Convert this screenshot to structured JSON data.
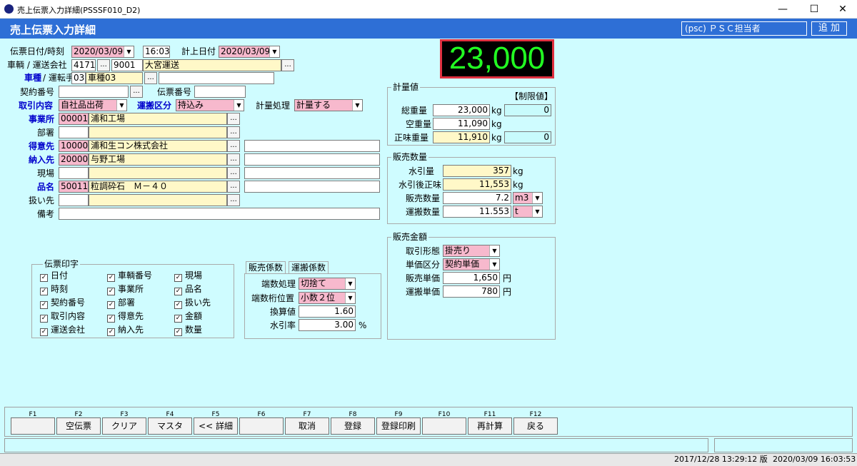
{
  "window": {
    "title": "売上伝票入力詳細(PSSSF010_D2)",
    "minimize": "—",
    "maximize": "☐",
    "close": "✕"
  },
  "header": {
    "title": "売上伝票入力詳細",
    "user": "(psc) ＰＳＣ担当者",
    "add_label": "追 加"
  },
  "big_weight": "23,000",
  "form": {
    "slip_date_label": "伝票日付/時刻",
    "slip_date": "2020/03/09",
    "slip_time": "16:03",
    "calc_date_label": "計上日付",
    "calc_date": "2020/03/09",
    "vehicle_label": "車輌 / 運送会社",
    "vehicle_no": "4171",
    "carrier_code": "9001",
    "carrier_name": "大宮運送",
    "vtype_label": "車種",
    "driver_label": "/ 運転手",
    "vtype_code": "03",
    "vtype_name": "車種03",
    "driver_value": "",
    "contract_label": "契約番号",
    "contract_value": "",
    "slip_no_label": "伝票番号",
    "slip_no_value": "",
    "trans_label": "取引内容",
    "trans_value": "自社品出荷",
    "transport_label": "運搬区分",
    "transport_value": "持込み",
    "weigh_label": "計量処理",
    "weigh_value": "計量する",
    "office_label": "事業所",
    "office_code": "00001",
    "office_name": "浦和工場",
    "dept_label": "部署",
    "dept_code": "",
    "dept_name": "",
    "customer_label": "得意先",
    "customer_code": "100000",
    "customer_name": "浦和生コン株式会社",
    "customer_extra": "",
    "delivery_label": "納入先",
    "delivery_code": "20000",
    "delivery_name": "与野工場",
    "delivery_extra": "",
    "site_label": "現場",
    "site_code": "",
    "site_name": "",
    "site_extra": "",
    "product_label": "品名",
    "product_code": "50011",
    "product_name": "粒調砕石　Ｍ－４０",
    "product_extra": "",
    "handler_label": "扱い先",
    "handler_code": "",
    "handler_name": "",
    "memo_label": "備考",
    "memo_value": ""
  },
  "print_group": {
    "caption": "伝票印字",
    "items": [
      "日付",
      "時刻",
      "契約番号",
      "取引内容",
      "運送会社",
      "車輌番号",
      "事業所",
      "部署",
      "得意先",
      "納入先",
      "現場",
      "品名",
      "扱い先",
      "金額",
      "数量"
    ]
  },
  "tabs": {
    "tab1": "販売係数",
    "tab2": "運搬係数",
    "round_label": "端数処理",
    "round_value": "切捨て",
    "digit_label": "端数桁位置",
    "digit_value": "小数２位",
    "conv_label": "換算値",
    "conv_value": "1.60",
    "water_label": "水引率",
    "water_value": "3.00",
    "water_unit": "%"
  },
  "weights": {
    "caption": "計量値",
    "limit_label": "【制限値】",
    "gross_label": "総重量",
    "gross": "23,000",
    "gross_limit": "0",
    "tare_label": "空重量",
    "tare": "11,090",
    "net_label": "正味重量",
    "net": "11,910",
    "net_limit": "0",
    "unit": "kg"
  },
  "sales_qty": {
    "caption": "販売数量",
    "water_label": "水引量",
    "water": "357",
    "water_unit": "kg",
    "after_label": "水引後正味",
    "after": "11,553",
    "after_unit": "kg",
    "qty_label": "販売数量",
    "qty": "7.2",
    "qty_unit": "m3",
    "transport_label": "運搬数量",
    "transport": "11.553",
    "transport_unit": "t"
  },
  "sales_amount": {
    "caption": "販売金額",
    "form_label": "取引形態",
    "form_value": "掛売り",
    "price_type_label": "単価区分",
    "price_type_value": "契約単価",
    "unit_price_label": "販売単価",
    "unit_price": "1,650",
    "unit_price_unit": "円",
    "trans_price_label": "運搬単価",
    "trans_price": "780",
    "trans_price_unit": "円"
  },
  "fkeys": [
    {
      "key": "F1",
      "label": ""
    },
    {
      "key": "F2",
      "label": "空伝票"
    },
    {
      "key": "F3",
      "label": "クリア"
    },
    {
      "key": "F4",
      "label": "マスタ"
    },
    {
      "key": "F5",
      "label": "<< 詳細"
    },
    {
      "key": "F6",
      "label": ""
    },
    {
      "key": "F7",
      "label": "取消"
    },
    {
      "key": "F8",
      "label": "登録"
    },
    {
      "key": "F9",
      "label": "登録印刷"
    },
    {
      "key": "F10",
      "label": ""
    },
    {
      "key": "F11",
      "label": "再計算"
    },
    {
      "key": "F12",
      "label": "戻る"
    }
  ],
  "status": {
    "version": "2017/12/28 13:29:12 版",
    "datetime": "2020/03/09 16:03:53"
  },
  "icons": {
    "ellipsis": "...",
    "dropdown": "▼",
    "check": "✓"
  }
}
